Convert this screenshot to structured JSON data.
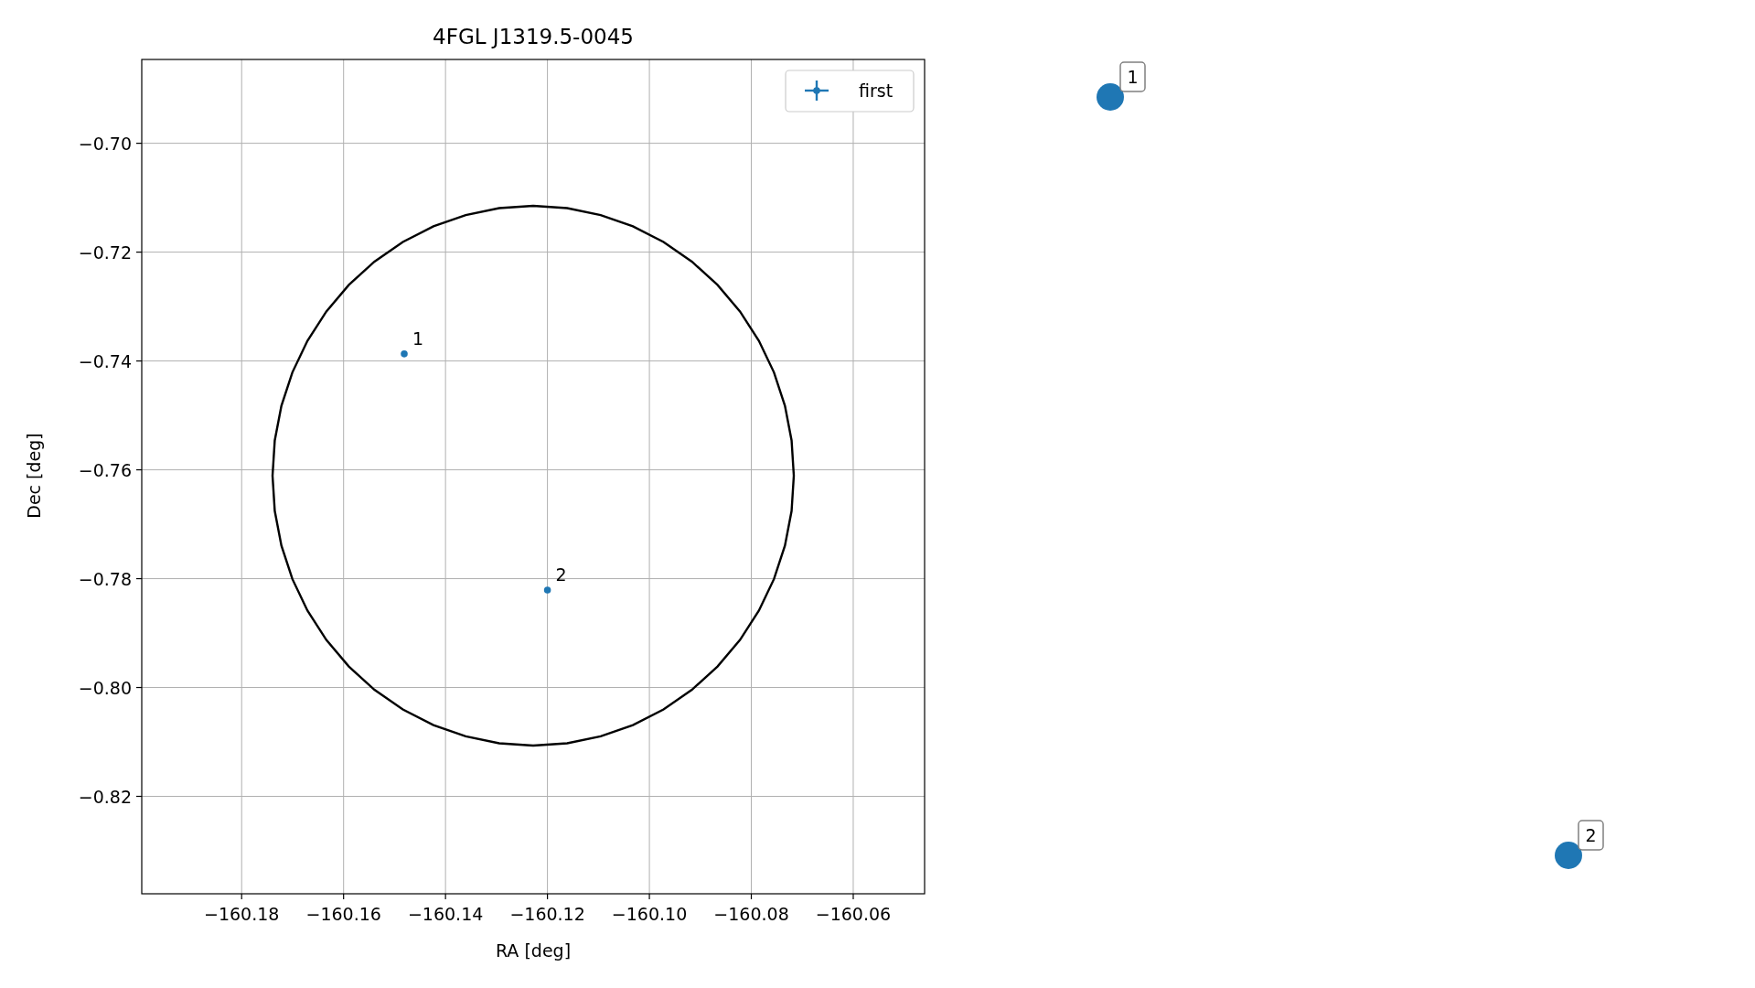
{
  "figure": {
    "chart_data": {
      "type": "scatter",
      "title": "4FGL J1319.5-0045",
      "xlabel": "RA [deg]",
      "ylabel": "Dec [deg]",
      "x": [
        -160.1481,
        -160.12
      ],
      "series": [
        {
          "name": "first",
          "color": "#1f77b4",
          "values": [
            -0.7387,
            -0.7821
          ]
        }
      ],
      "xlim": [
        -160.1996,
        -160.046
      ],
      "ylim": [
        -0.8379,
        -0.6846
      ],
      "xticks": [
        {
          "value": -160.18,
          "label": "−160.18"
        },
        {
          "value": -160.16,
          "label": "−160.16"
        },
        {
          "value": -160.14,
          "label": "−160.14"
        },
        {
          "value": -160.12,
          "label": "−160.12"
        },
        {
          "value": -160.1,
          "label": "−160.10"
        },
        {
          "value": -160.08,
          "label": "−160.08"
        },
        {
          "value": -160.06,
          "label": "−160.06"
        }
      ],
      "yticks": [
        {
          "value": -0.7,
          "label": "−0.70"
        },
        {
          "value": -0.72,
          "label": "−0.72"
        },
        {
          "value": -0.74,
          "label": "−0.74"
        },
        {
          "value": -0.76,
          "label": "−0.76"
        },
        {
          "value": -0.78,
          "label": "−0.78"
        },
        {
          "value": -0.8,
          "label": "−0.80"
        },
        {
          "value": -0.82,
          "label": "−0.82"
        }
      ],
      "grid": true,
      "annotations": [
        {
          "text": "1",
          "x": -160.1481,
          "y": -0.7387
        },
        {
          "text": "2",
          "x": -160.12,
          "y": -0.7821
        }
      ]
    },
    "outside_markers": [
      {
        "label": "1"
      },
      {
        "label": "2"
      }
    ]
  }
}
